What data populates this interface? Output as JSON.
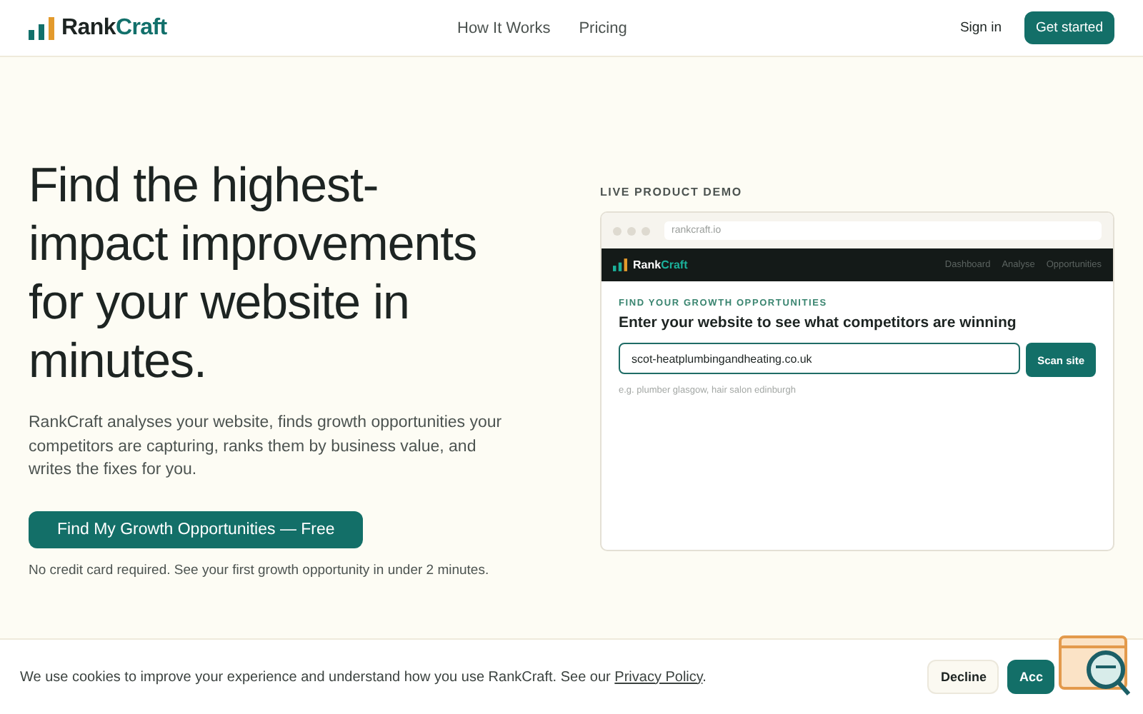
{
  "header": {
    "logo": {
      "first": "Rank",
      "second": "Craft"
    },
    "nav": [
      "How It Works",
      "Pricing"
    ],
    "sign_in": "Sign in",
    "cta": "Get started"
  },
  "hero": {
    "headline": "Find the highest-impact improvements for your website in minutes.",
    "lead": "RankCraft analyses your website, finds growth opportunities your competitors are capturing, ranks them by business value, and writes the fixes for you.",
    "button": "Find My Growth Opportunities — Free",
    "note": "No credit card required. See your first growth opportunity in under 2 minutes."
  },
  "demo": {
    "label": "LIVE PRODUCT DEMO",
    "url": "rankcraft.io",
    "app_logo": {
      "first": "Rank",
      "second": "Craft"
    },
    "app_nav": [
      "Dashboard",
      "Analyse",
      "Opportunities"
    ],
    "eyebrow": "FIND YOUR GROWTH OPPORTUNITIES",
    "heading": "Enter your website to see what competitors are winning",
    "input_value": "scot-heatplumbingandheating.co.uk",
    "scan_button": "Scan site",
    "hint": "e.g. plumber glasgow, hair salon edinburgh"
  },
  "cookie_bar": {
    "text": "We use cookies to improve your experience and understand how you use RankCraft. See our",
    "link": "Privacy Policy",
    "end": ".",
    "decline": "Decline",
    "accept": "Acc"
  }
}
